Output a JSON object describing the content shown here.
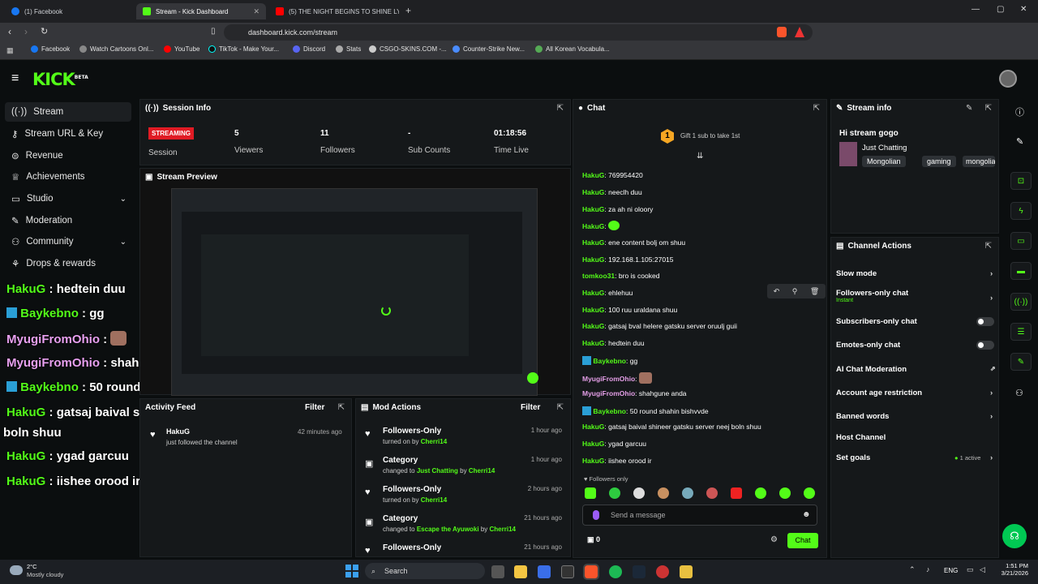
{
  "browser": {
    "tabs": [
      {
        "label": "(1) Facebook",
        "color": "#1877f2"
      },
      {
        "label": "Stream - Kick Dashboard",
        "color": "#53fc18"
      },
      {
        "label": "(5) THE NIGHT BEGINS TO SHINE LYI",
        "color": "#ff0000"
      }
    ],
    "url": "dashboard.kick.com/stream",
    "bookmarks": [
      {
        "label": "Facebook"
      },
      {
        "label": "Watch Cartoons Onl..."
      },
      {
        "label": "YouTube"
      },
      {
        "label": "TikTok - Make Your..."
      },
      {
        "label": "Discord"
      },
      {
        "label": "Stats"
      },
      {
        "label": "CSGO-SKINS.COM -..."
      },
      {
        "label": "Counter-Strike New..."
      },
      {
        "label": "All Korean Vocabula..."
      }
    ]
  },
  "app": {
    "logo": "KICK",
    "beta": "BETA"
  },
  "sidebar": {
    "items": [
      {
        "label": "Stream",
        "icon": "radio-icon"
      },
      {
        "label": "Stream URL & Key",
        "icon": "key-icon"
      },
      {
        "label": "Revenue",
        "icon": "coin-icon"
      },
      {
        "label": "Achievements",
        "icon": "trophy-icon"
      },
      {
        "label": "Studio",
        "icon": "studio-icon"
      },
      {
        "label": "Moderation",
        "icon": "wrench-icon"
      },
      {
        "label": "Community",
        "icon": "users-icon"
      },
      {
        "label": "Drops & rewards",
        "icon": "gift-icon"
      }
    ]
  },
  "overlay_chat": [
    {
      "user": "HakuG",
      "text": "hedtein duu"
    },
    {
      "user": "Baykebno",
      "text": "gg"
    },
    {
      "user": "MyugiFromOhio",
      "text": ""
    },
    {
      "user": "MyugiFromOhio",
      "text": "shahgune anda"
    },
    {
      "user": "Baykebno",
      "text": "50 round shahin bishvvde"
    },
    {
      "user": "HakuG",
      "text": "gatsaj baival shineer gatsku server neej"
    },
    {
      "user": "",
      "text": "boln shuu"
    },
    {
      "user": "HakuG",
      "text": "ygad garcuu"
    },
    {
      "user": "HakuG",
      "text": "iishee orood ir"
    }
  ],
  "session": {
    "title": "Session Info",
    "status": "STREAMING",
    "status_label": "Session",
    "stats": [
      {
        "value": "5",
        "label": "Viewers"
      },
      {
        "value": "11",
        "label": "Followers"
      },
      {
        "value": "-",
        "label": "Sub Counts"
      },
      {
        "value": "01:18:56",
        "label": "Time Live"
      }
    ]
  },
  "preview": {
    "title": "Stream Preview"
  },
  "activity": {
    "title": "Activity Feed",
    "filter": "Filter",
    "items": [
      {
        "user": "HakuG",
        "text": "just followed the channel",
        "time": "42 minutes ago"
      }
    ]
  },
  "mod_actions": {
    "title": "Mod Actions",
    "filter": "Filter",
    "items": [
      {
        "title": "Followers-Only",
        "pre": "turned on by",
        "target": "",
        "by": "Cherri14",
        "time": "1 hour ago"
      },
      {
        "title": "Category",
        "pre": "changed to",
        "target": "Just Chatting",
        "by": "Cherri14",
        "time": "1 hour ago"
      },
      {
        "title": "Followers-Only",
        "pre": "turned on by",
        "target": "",
        "by": "Cherri14",
        "time": "2 hours ago"
      },
      {
        "title": "Category",
        "pre": "changed to",
        "target": "Escape the Ayuwoki",
        "by": "Cherri14",
        "time": "21 hours ago"
      },
      {
        "title": "Followers-Only",
        "pre": "",
        "target": "",
        "by": "",
        "time": "21 hours ago"
      }
    ]
  },
  "chat": {
    "title": "Chat",
    "gift_count": "1",
    "gift_text": "Gift 1 sub to take 1st",
    "messages": [
      {
        "user": "HakuG",
        "text": "769954420"
      },
      {
        "user": "HakuG",
        "text": "neeclh duu"
      },
      {
        "user": "HakuG",
        "text": "za ah ni oloory"
      },
      {
        "user": "HakuG",
        "text": ""
      },
      {
        "user": "HakuG",
        "text": "ene content bolj om shuu"
      },
      {
        "user": "HakuG",
        "text": "192.168.1.105:27015"
      },
      {
        "user": "tomkoo31",
        "text": "bro is cooked"
      },
      {
        "user": "HakuG",
        "text": "ehlehuu"
      },
      {
        "user": "HakuG",
        "text": "100 ruu uraldana shuu"
      },
      {
        "user": "HakuG",
        "text": "gatsaj bval helere gatsku server oruulj guii"
      },
      {
        "user": "HakuG",
        "text": "hedtein duu"
      },
      {
        "user": "Baykebno",
        "text": "gg"
      },
      {
        "user": "MyugiFromOhio",
        "text": ""
      },
      {
        "user": "MyugiFromOhio",
        "text": "shahgune anda"
      },
      {
        "user": "Baykebno",
        "text": "50 round shahin bishvvde"
      },
      {
        "user": "HakuG",
        "text": "gatsaj baival shineer gatsku server neej boln shuu"
      },
      {
        "user": "HakuG",
        "text": "ygad garcuu"
      },
      {
        "user": "HakuG",
        "text": "iishee orood ir"
      }
    ],
    "mode_note": "Followers only",
    "placeholder": "Send a message",
    "points": "0",
    "send": "Chat"
  },
  "stream_info": {
    "title": "Stream info",
    "stream_title": "Hi stream gogo",
    "category": "Just Chatting",
    "tags": [
      "Mongolian",
      "gaming",
      "mongolian"
    ]
  },
  "channel_actions": {
    "title": "Channel Actions",
    "items": [
      {
        "label": "Slow mode",
        "kind": "chevron"
      },
      {
        "label": "Followers-only chat",
        "sub": "Instant",
        "kind": "chevron"
      },
      {
        "label": "Subscribers-only chat",
        "kind": "toggle"
      },
      {
        "label": "Emotes-only chat",
        "kind": "toggle"
      },
      {
        "label": "AI Chat Moderation",
        "kind": "external"
      },
      {
        "label": "Account age restriction",
        "kind": "chevron"
      },
      {
        "label": "Banned words",
        "kind": "chevron"
      },
      {
        "label": "Host Channel",
        "kind": "none"
      },
      {
        "label": "Set goals",
        "kind": "chevron",
        "sub": "1 active"
      }
    ]
  },
  "taskbar": {
    "weather_temp": "2°C",
    "weather_desc": "Mostly cloudy",
    "search": "Search",
    "lang": "ENG",
    "time": "1:51 PM",
    "date": "3/21/2026"
  }
}
